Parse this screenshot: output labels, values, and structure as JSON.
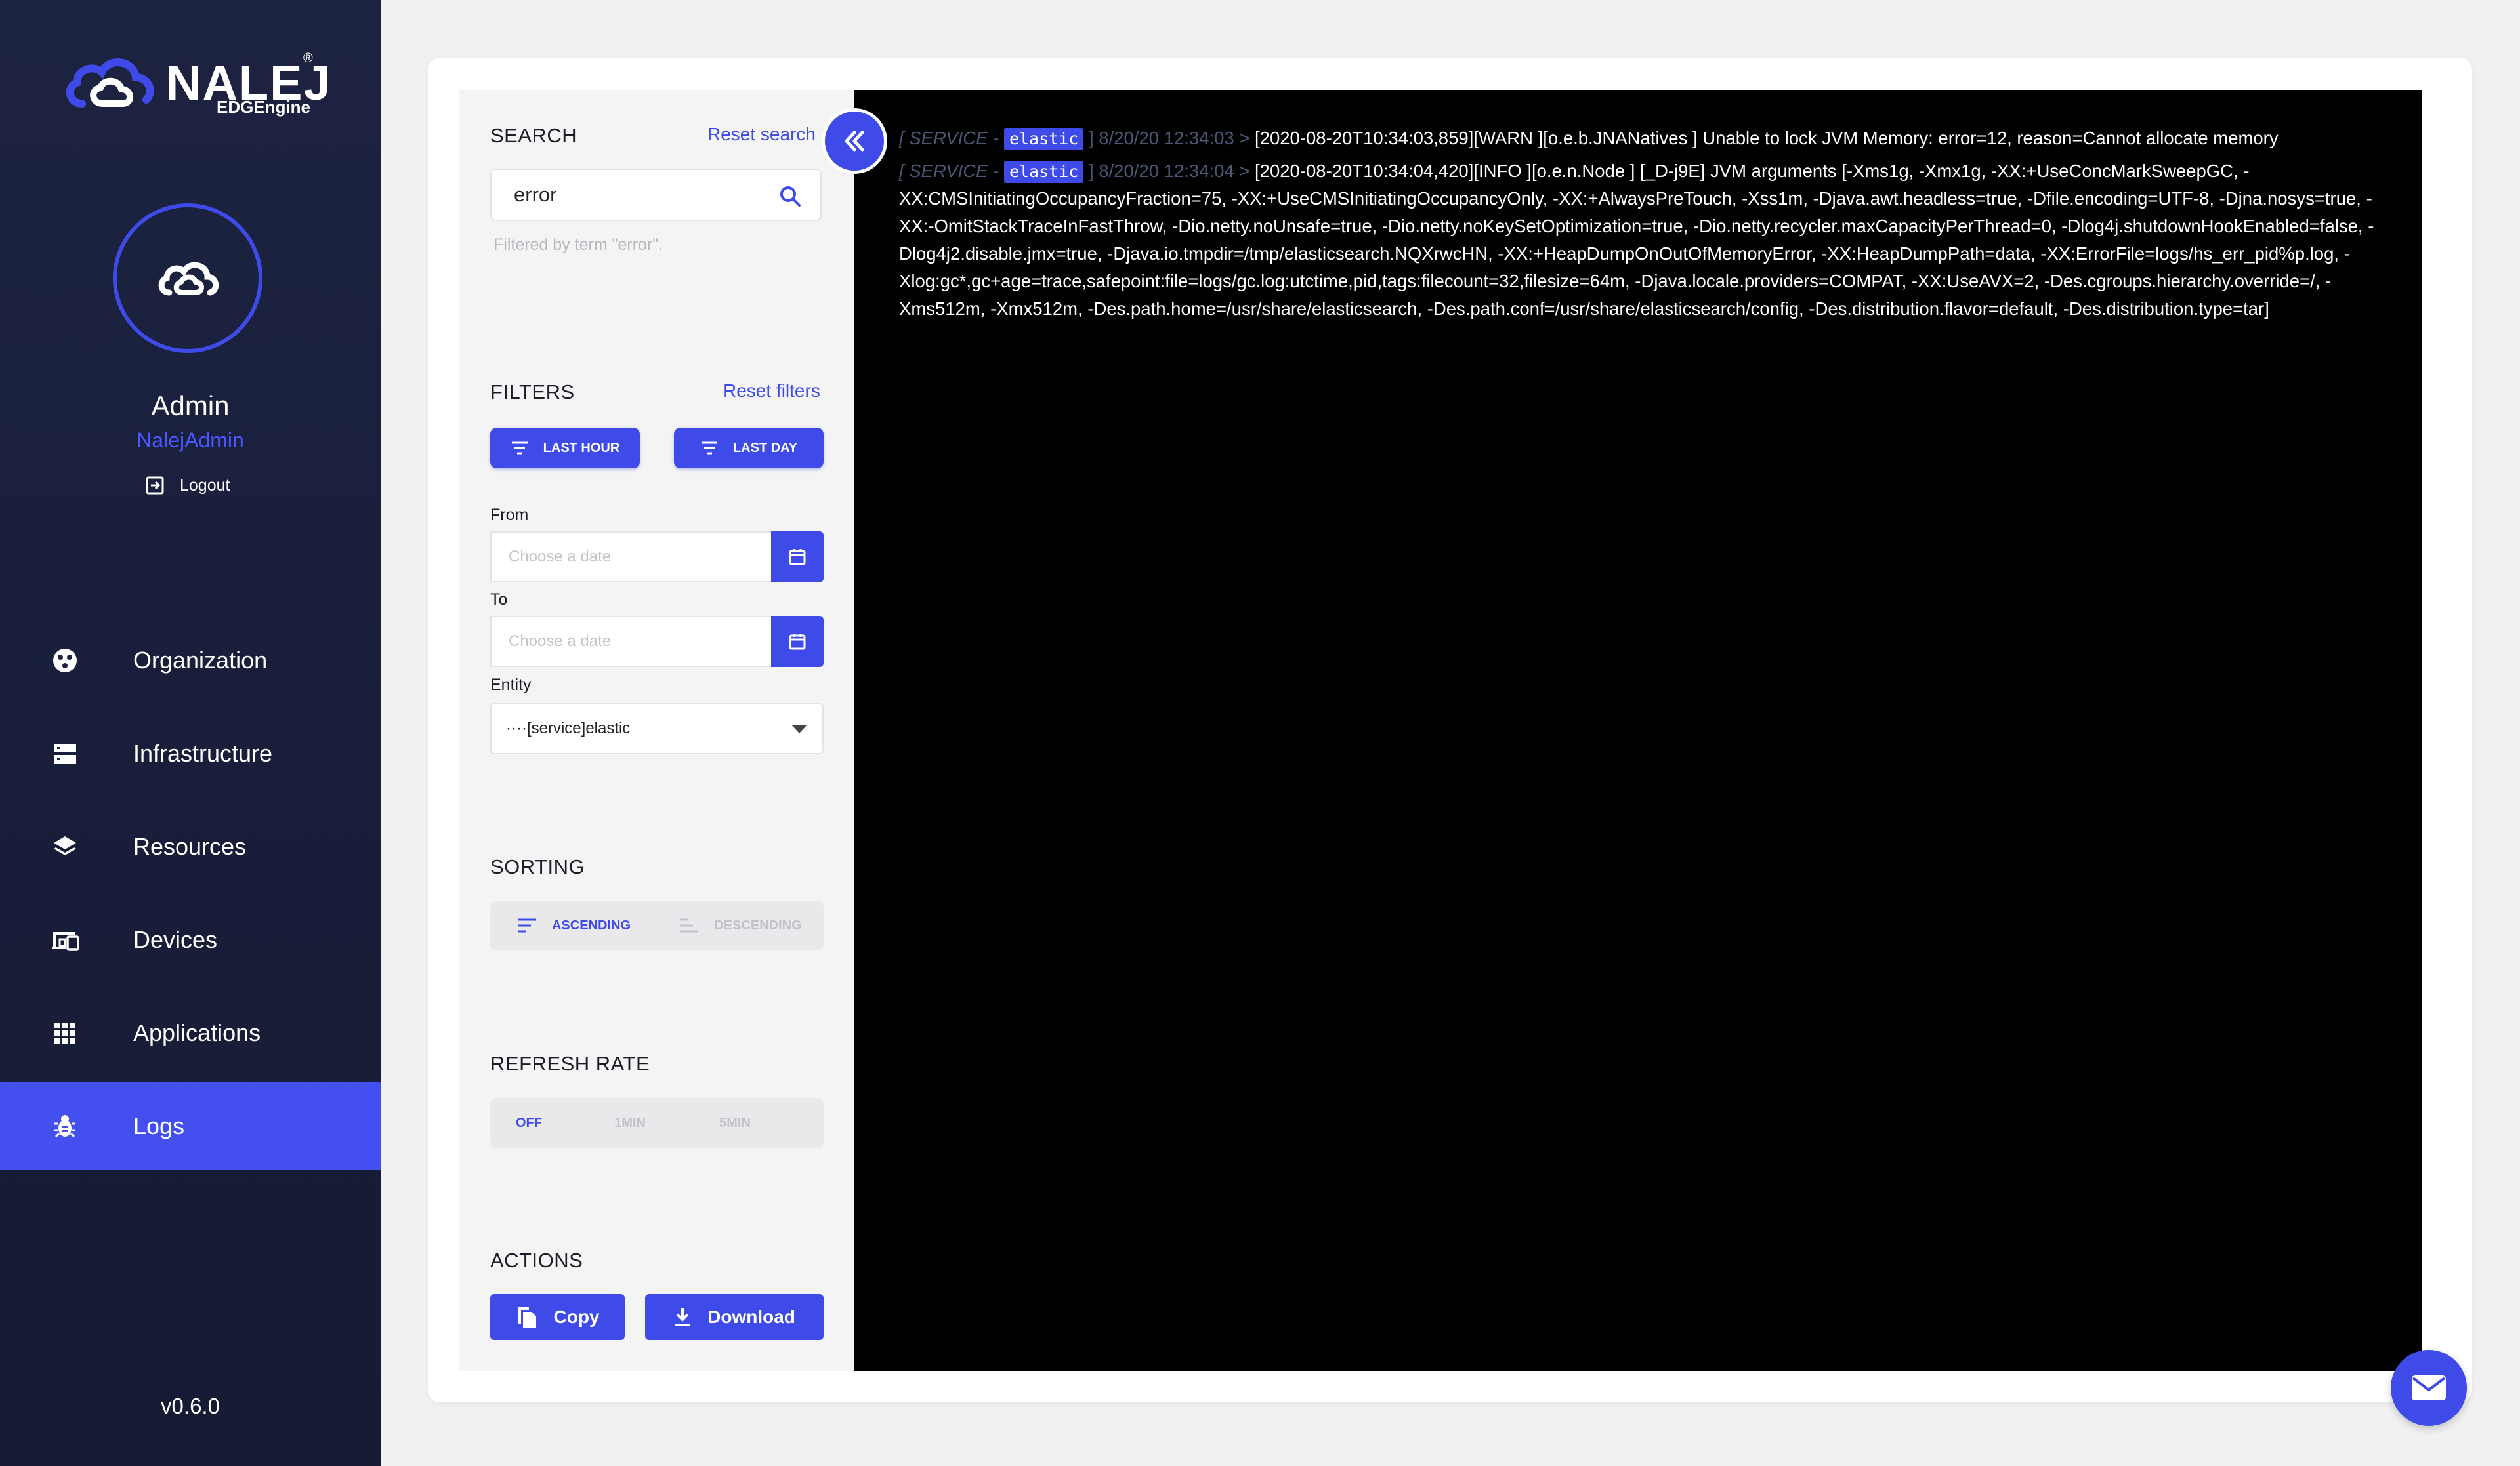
{
  "brand": {
    "name": "NALEJ",
    "registered": "®",
    "product": "EDGEngine"
  },
  "user": {
    "name": "Admin",
    "role": "NalejAdmin",
    "logout_label": "Logout"
  },
  "nav": {
    "items": [
      {
        "label": "Organization",
        "icon": "organization-icon"
      },
      {
        "label": "Infrastructure",
        "icon": "server-icon"
      },
      {
        "label": "Resources",
        "icon": "layers-icon"
      },
      {
        "label": "Devices",
        "icon": "devices-icon"
      },
      {
        "label": "Applications",
        "icon": "grid-icon"
      },
      {
        "label": "Logs",
        "icon": "bug-icon",
        "active": true
      }
    ]
  },
  "version": "v0.6.0",
  "search": {
    "title": "SEARCH",
    "reset_label": "Reset search",
    "value": "error",
    "hint": "Filtered by term \"error\"."
  },
  "filters": {
    "title": "FILTERS",
    "reset_label": "Reset filters",
    "last_hour": "LAST HOUR",
    "last_day": "LAST DAY",
    "from_label": "From",
    "to_label": "To",
    "date_placeholder": "Choose a date",
    "entity_label": "Entity",
    "entity_value": "····[service]elastic"
  },
  "sorting": {
    "title": "SORTING",
    "ascending": "ASCENDING",
    "descending": "DESCENDING",
    "selected": "ascending"
  },
  "refresh": {
    "title": "REFRESH RATE",
    "options": [
      "OFF",
      "1MIN",
      "5MIN"
    ],
    "selected": "OFF"
  },
  "actions": {
    "title": "ACTIONS",
    "copy": "Copy",
    "download": "Download"
  },
  "logs": [
    {
      "type_label": "[ SERVICE -",
      "tag": "elastic",
      "date": "] 8/20/20 12:34:03 >",
      "message": "[2020-08-20T10:34:03,859][WARN ][o.e.b.JNANatives ] Unable to lock JVM Memory: error=12, reason=Cannot allocate memory"
    },
    {
      "type_label": "[ SERVICE -",
      "tag": "elastic",
      "date": "] 8/20/20 12:34:04 >",
      "message": "[2020-08-20T10:34:04,420][INFO ][o.e.n.Node ] [_D-j9E] JVM arguments [-Xms1g, -Xmx1g, -XX:+UseConcMarkSweepGC, -XX:CMSInitiatingOccupancyFraction=75, -XX:+UseCMSInitiatingOccupancyOnly, -XX:+AlwaysPreTouch, -Xss1m, -Djava.awt.headless=true, -Dfile.encoding=UTF-8, -Djna.nosys=true, -XX:-OmitStackTraceInFastThrow, -Dio.netty.noUnsafe=true, -Dio.netty.noKeySetOptimization=true, -Dio.netty.recycler.maxCapacityPerThread=0, -Dlog4j.shutdownHookEnabled=false, -Dlog4j2.disable.jmx=true, -Djava.io.tmpdir=/tmp/elasticsearch.NQXrwcHN, -XX:+HeapDumpOnOutOfMemoryError, -XX:HeapDumpPath=data, -XX:ErrorFile=logs/hs_err_pid%p.log, -Xlog:gc*,gc+age=trace,safepoint:file=logs/gc.log:utctime,pid,tags:filecount=32,filesize=64m, -Djava.locale.providers=COMPAT, -XX:UseAVX=2, -Des.cgroups.hierarchy.override=/, -Xms512m, -Xmx512m, -Des.path.home=/usr/share/elasticsearch, -Des.path.conf=/usr/share/elasticsearch/config, -Des.distribution.flavor=default, -Des.distribution.type=tar]"
    }
  ],
  "colors": {
    "accent": "#3f4be8",
    "sidebar": "#1c2341",
    "console_bg": "#000000",
    "meta": "#4e5675"
  }
}
